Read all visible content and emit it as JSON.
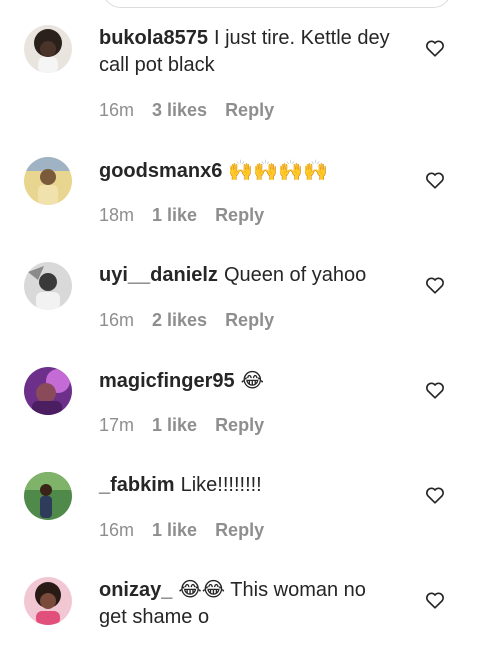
{
  "comments": [
    {
      "username": "bukola8575",
      "text": "I just tire. Kettle dey call pot black",
      "time": "16m",
      "likes": "3 likes",
      "reply": "Reply",
      "avatar": "avatar-dark"
    },
    {
      "username": "goodsmanx6",
      "text": "🙌🙌🙌🙌",
      "time": "18m",
      "likes": "1 like",
      "reply": "Reply",
      "avatar": "avatar-yellow"
    },
    {
      "username": "uyi__danielz",
      "text": "Queen of yahoo",
      "time": "16m",
      "likes": "2 likes",
      "reply": "Reply",
      "avatar": "avatar-gray"
    },
    {
      "username": "magicfinger95",
      "text": "😂",
      "time": "17m",
      "likes": "1 like",
      "reply": "Reply",
      "avatar": "avatar-purple"
    },
    {
      "username": "_fabkim",
      "text": "Like!!!!!!!!",
      "time": "16m",
      "likes": "1 like",
      "reply": "Reply",
      "avatar": "avatar-green"
    },
    {
      "username": "onizay_",
      "text": "😂😂 This woman no get shame o",
      "time": "",
      "likes": "",
      "reply": "",
      "avatar": "avatar-pink"
    }
  ],
  "icons": {
    "like": "heart-outline-icon"
  }
}
